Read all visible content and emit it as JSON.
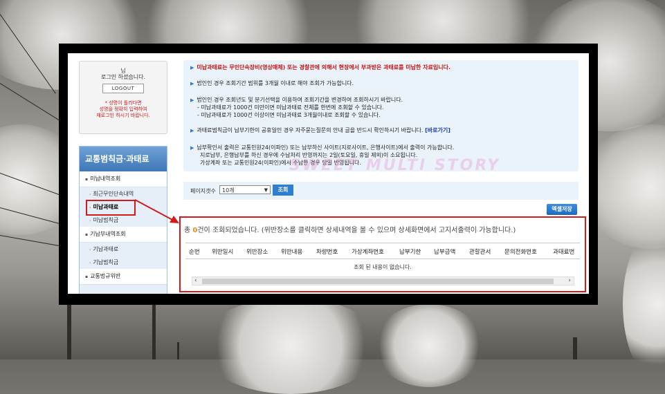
{
  "login": {
    "user_suffix": "님",
    "logged_in": "로그인 하셨습니다.",
    "logout": "LOGOUT",
    "notice_line1": "* 성명이 틀리다면",
    "notice_line2": "성명을 정확히 입력하여",
    "notice_line3": "재로그인 하시기 바랍니다."
  },
  "sidebar": {
    "title": "교통범칙금·과태료",
    "group1": "미납내역조회",
    "items": [
      "최근무인단속내역",
      "미납과태료",
      "미납범칙금"
    ],
    "group2": "기납부내역조회",
    "items2": [
      "기납과태료",
      "기납범칙금"
    ],
    "group3": "교통법규위반"
  },
  "info": {
    "line1": "미납과태료는 무인단속장비(영상매체) 또는 경찰관에 의해서 현장에서 부과받은 과태료를 미납한 자료입니다.",
    "line2": "법인인 경우 조회기간 범위를 3개월 이내로 해야 조회가 가능합니다.",
    "line3": "법인인 경우 조회년도 및 분기선택을 이용하여 조회기간을 변경하여 조회하시기 바랍니다.",
    "line3a": "- 미납과태료가 1000건 미만이면 미납과태료 전체를 한번에 조회할 수 있습니다.",
    "line3b": "- 미납과태료가 1000건 이상이면 미납과태료 3개월이내로 조회할 수 있습니다.",
    "line4": "과태료범칙금이 납부기한이 공휴일인 경우 자주묻는질문의 안내 글을 반드시 확인하시기 바랍니다.",
    "line4_link": "[바로가기]",
    "line5": "납부확인서 출력은 교통민원24(이파인) 또는 납부하신 사이트(지로사이트, 은행사이트)에서 출력이 가능합니다.",
    "line5a": "지로납부, 은행납부를 하신 경우에 수납처리 반영까지는 2일(토요일, 휴일 제외)이 소요됩니다.",
    "line5b": "가상계좌 또는 교통민원24(이파인)에서 수납한 경우 당일 반영됩니다."
  },
  "watermark": "SWEET MULTI STORY",
  "page_size": {
    "label": "페이지갯수",
    "value": "10개"
  },
  "search_button": "조회",
  "excel_button": "엑셀저장",
  "result": {
    "prefix": "총 ",
    "count": "0",
    "suffix": "건이 조회되었습니다. (위반장소를 클릭하면 상세내역을 볼 수 있으며 상세화면에서 고지서출력이 가능합니다.)",
    "columns": [
      "순번",
      "위반일시",
      "위반장소",
      "위반내용",
      "차량번호",
      "가상계좌번호",
      "납부기한",
      "납부금액",
      "관할관서",
      "문의전화번호",
      "과태료번"
    ],
    "empty": "조회 된 내용이 없습니다."
  }
}
